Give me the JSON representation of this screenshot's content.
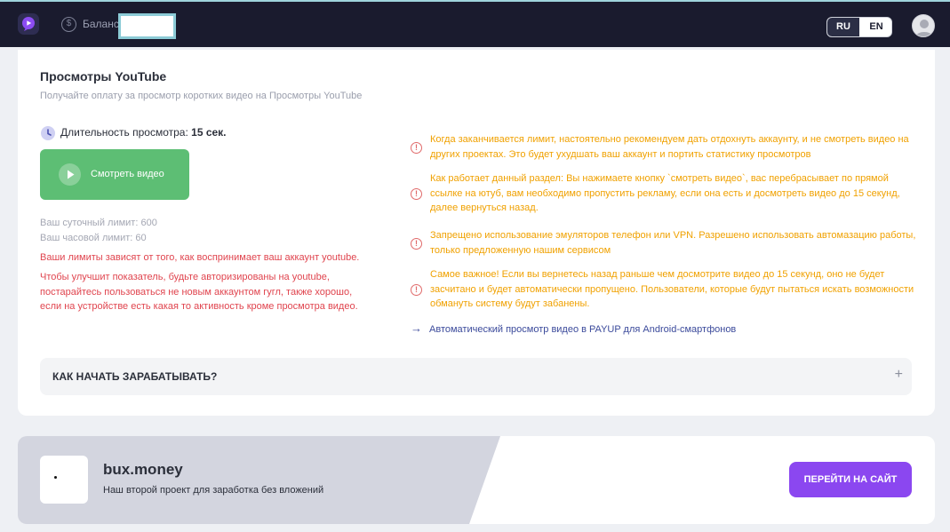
{
  "header": {
    "logo_icon": "play-logo-icon",
    "balance_icon": "dollar-circle-icon",
    "balance_label": "Баланс",
    "balance_value": "",
    "languages": [
      "RU",
      "EN"
    ],
    "active_language": "RU",
    "avatar_icon": "user-avatar-icon"
  },
  "task": {
    "title": "Просмотры YouTube",
    "subtitle": "Получайте оплату за просмотр коротких видео на Просмотры YouTube",
    "duration_label": "Длительность просмотра:",
    "duration_value": "15 сек.",
    "watch_button": "Смотреть видео",
    "daily_limit": "Ваш суточный лимит: 600",
    "hourly_limit": "Ваш часовой лимит: 60",
    "limits_note": "Ваши лимиты зависят от того, как воспринимает ваш аккаунт youtube.",
    "improve_line1": "Чтобы улучшит показатель, будьте авторизированы на youtube,",
    "improve_line2": "постарайтесь пользоваться не новым аккаунтом гугл, также хорошо,",
    "improve_line3": "если на устройстве есть какая то активность кроме просмотра видео."
  },
  "warnings": [
    {
      "icon": "info-circle-icon",
      "text": "Когда заканчивается лимит, настоятельно рекомендуем дать отдохнуть аккаунту, и не смотреть видео на других проектах. Это будет ухудшать ваш аккаунт и портить статистику просмотров"
    },
    {
      "icon": "info-circle-icon",
      "text": "Как работает данный раздел: Вы нажимаете кнопку `смотреть видео`, вас перебрасывает по прямой ссылке на ютуб, вам необходимо пропустить рекламу, если она есть и досмотреть видео до 15 секунд, далее вернуться назад."
    },
    {
      "icon": "info-circle-icon",
      "text": "Запрещено использование эмуляторов телефон или VPN. Разрешено использовать автомазацию работы, только предложенную нашим сервисом"
    },
    {
      "icon": "info-circle-icon",
      "text": "Самое важное! Если вы вернетесь назад раньше чем досмотрите видео до 15 секунд, оно не будет засчитано и будет автоматически пропущено. Пользователи, которые будут пытаться искать возможности обмануть систему будут забанены."
    }
  ],
  "auto_link": {
    "icon": "arrow-right-icon",
    "text": "Автоматический просмотр видео в PAYUP для Android-смартфонов"
  },
  "faq": {
    "question": "КАК НАЧАТЬ ЗАРАБАТЫВАТЬ?",
    "toggle": "+"
  },
  "promo": {
    "name": "bux.money",
    "description": "Наш второй проект для заработка без вложений",
    "button": "ПЕРЕЙТИ НА САЙТ"
  },
  "colors": {
    "header_bg": "#1a1b2e",
    "watch_button": "#5dbe74",
    "warning_text": "#f0a100",
    "error_text": "#e0444e",
    "promo_button": "#8b47f0"
  }
}
